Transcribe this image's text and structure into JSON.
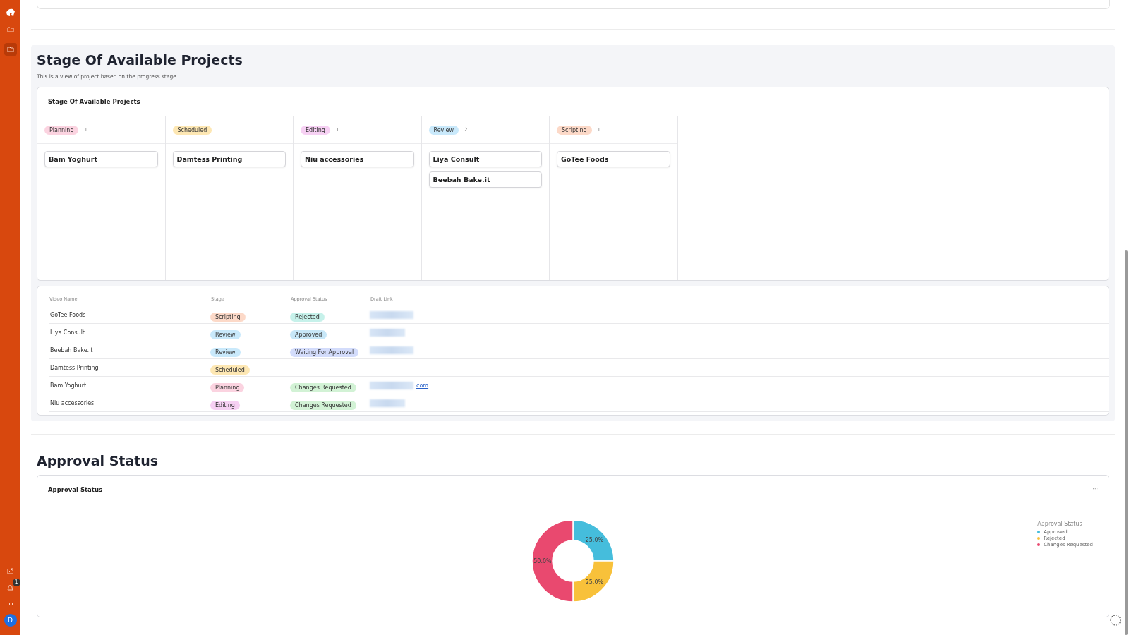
{
  "stage_section": {
    "title": "Stage Of Available Projects",
    "subtitle": "This is a view of project based on the progress stage",
    "board": {
      "title": "Stage Of Available Projects",
      "columns": [
        {
          "label": "Planning",
          "count": "1",
          "color": "#fbd3e0",
          "cards": [
            "Bam Yoghurt"
          ]
        },
        {
          "label": "Scheduled",
          "count": "1",
          "color": "#fde7b3",
          "cards": [
            "Damtess Printing"
          ]
        },
        {
          "label": "Editing",
          "count": "1",
          "color": "#f6d0f3",
          "cards": [
            "Niu accessories"
          ]
        },
        {
          "label": "Review",
          "count": "2",
          "color": "#c9e9fb",
          "cards": [
            "Liya Consult",
            "Beebah Bake.it"
          ]
        },
        {
          "label": "Scripting",
          "count": "1",
          "color": "#fcd9c8",
          "cards": [
            "GoTee Foods"
          ]
        }
      ]
    },
    "table": {
      "columns": [
        "Video Name",
        "Stage",
        "Approval Status",
        "Draft Link"
      ],
      "rows": [
        {
          "name": "GoTee Foods",
          "stage": {
            "label": "Scripting",
            "color": "#fcd9c8"
          },
          "approval": {
            "label": "Rejected",
            "color": "#c6f1ea"
          }
        },
        {
          "name": "Liya Consult",
          "stage": {
            "label": "Review",
            "color": "#c9e9fb"
          },
          "approval": {
            "label": "Approved",
            "color": "#c7e7f8"
          }
        },
        {
          "name": "Beebah Bake.it",
          "stage": {
            "label": "Review",
            "color": "#c9e9fb"
          },
          "approval": {
            "label": "Waiting For Approval",
            "color": "#d3dcfb"
          }
        },
        {
          "name": "Damtess Printing",
          "stage": {
            "label": "Scheduled",
            "color": "#fde7b3"
          },
          "approval_empty": "–"
        },
        {
          "name": "Bam Yoghurt",
          "stage": {
            "label": "Planning",
            "color": "#fbd3e0"
          },
          "approval": {
            "label": "Changes Requested",
            "color": "#d2f2d5"
          },
          "link_tail": "com"
        },
        {
          "name": "Niu accessories",
          "stage": {
            "label": "Editing",
            "color": "#f6d0f3"
          },
          "approval": {
            "label": "Changes Requested",
            "color": "#d2f2d5"
          }
        }
      ]
    }
  },
  "approval_section": {
    "title": "Approval Status",
    "card_title": "Approval Status",
    "menu": "···",
    "chart_data": {
      "type": "donut",
      "categories": [
        "Approved",
        "Rejected",
        "Changes Requested"
      ],
      "series": [
        {
          "name": "Approval Status",
          "values": [
            25,
            25,
            50
          ]
        }
      ],
      "colors": [
        "#45bddc",
        "#f8c13a",
        "#e9496f"
      ],
      "value_labels": [
        "25.0%",
        "25.0%",
        "50.0%"
      ]
    }
  },
  "sidebar": {
    "notification_count": "1",
    "avatar": "D"
  }
}
